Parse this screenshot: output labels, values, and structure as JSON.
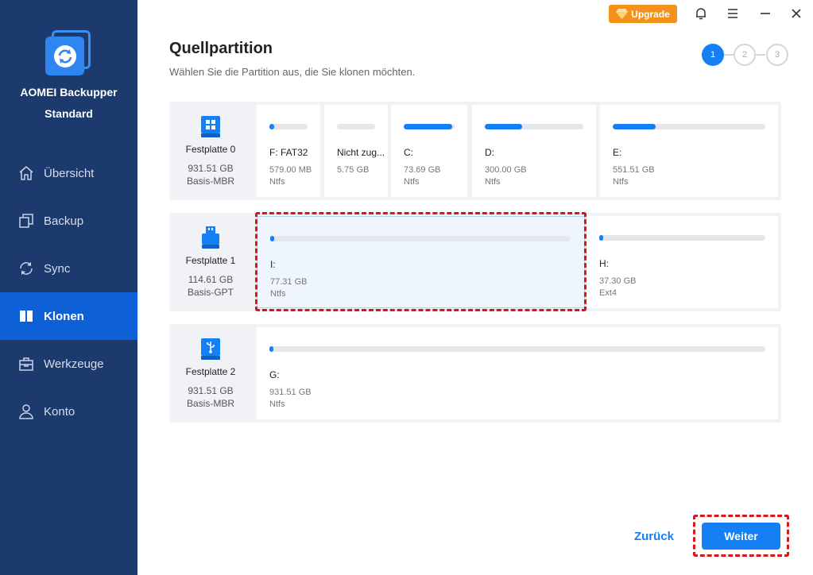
{
  "app": {
    "name": "AOMEI Backupper",
    "edition": "Standard"
  },
  "titlebar": {
    "upgrade_label": "Upgrade"
  },
  "nav": [
    {
      "label": "Übersicht",
      "icon": "home-icon"
    },
    {
      "label": "Backup",
      "icon": "copy-icon"
    },
    {
      "label": "Sync",
      "icon": "sync-icon"
    },
    {
      "label": "Klonen",
      "icon": "clone-icon",
      "active": true
    },
    {
      "label": "Werkzeuge",
      "icon": "toolbox-icon"
    },
    {
      "label": "Konto",
      "icon": "user-icon"
    }
  ],
  "header": {
    "title": "Quellpartition",
    "subtitle": "Wählen Sie die Partition aus, die Sie klonen möchten.",
    "steps": [
      "1",
      "2",
      "3"
    ],
    "current_step": 1
  },
  "disks": [
    {
      "name": "Festplatte 0",
      "size": "931.51 GB",
      "type": "Basis-MBR",
      "icon": "windows-disk-icon",
      "partitions": [
        {
          "label": "F: FAT32",
          "size": "579.00 MB",
          "fs": "Ntfs",
          "used": 0.12
        },
        {
          "label": "Nicht zug...",
          "size": "5.75 GB",
          "fs": "",
          "used": 0
        },
        {
          "label": "C:",
          "size": "73.69 GB",
          "fs": "Ntfs",
          "used": 0.95
        },
        {
          "label": "D:",
          "size": "300.00 GB",
          "fs": "Ntfs",
          "used": 0.38
        },
        {
          "label": "E:",
          "size": "551.51 GB",
          "fs": "Ntfs",
          "used": 0.28
        }
      ]
    },
    {
      "name": "Festplatte 1",
      "size": "114.61 GB",
      "type": "Basis-GPT",
      "icon": "usb-drive-icon",
      "partitions": [
        {
          "label": "I:",
          "size": "77.31 GB",
          "fs": "Ntfs",
          "used": 0.01,
          "selected": true
        },
        {
          "label": "H:",
          "size": "37.30 GB",
          "fs": "Ext4",
          "used": 0.02
        }
      ]
    },
    {
      "name": "Festplatte 2",
      "size": "931.51 GB",
      "type": "Basis-MBR",
      "icon": "usb-disk-icon",
      "partitions": [
        {
          "label": "G:",
          "size": "931.51 GB",
          "fs": "Ntfs",
          "used": 0.005
        }
      ]
    }
  ],
  "footer": {
    "back_label": "Zurück",
    "next_label": "Weiter"
  },
  "colors": {
    "sidebar": "#1d3a6e",
    "accent": "#1480f3",
    "upgrade": "#f2921d",
    "highlight": "#d61818"
  }
}
